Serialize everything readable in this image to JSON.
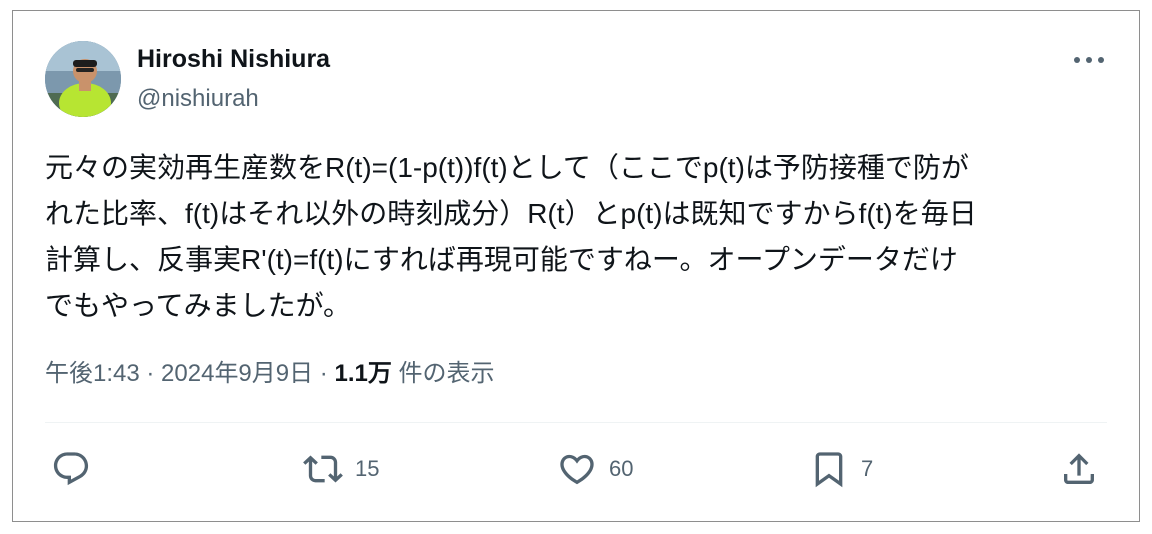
{
  "author": {
    "name": "Hiroshi Nishiura",
    "handle": "@nishiurah"
  },
  "tweet": {
    "lines": [
      "元々の実効再生産数をR(t)=(1-p(t))f(t)として（ここでp(t)は予防接種で防が",
      "れた比率、f(t)はそれ以外の時刻成分）R(t）とp(t)は既知ですからf(t)を毎日",
      "計算し、反事実R'(t)=f(t)にすれば再現可能ですねー。オープンデータだけ",
      "でもやってみましたが。"
    ]
  },
  "meta": {
    "time": "午後1:43",
    "sep1": " · ",
    "date": "2024年9月9日",
    "sep2": " · ",
    "views_count": "1.1万",
    "views_label": " 件の表示"
  },
  "actions": {
    "reply": {
      "icon": "reply-icon",
      "count": ""
    },
    "repost": {
      "icon": "repost-icon",
      "count": "15"
    },
    "like": {
      "icon": "heart-icon",
      "count": "60"
    },
    "bookmark": {
      "icon": "bookmark-icon",
      "count": "7"
    },
    "share": {
      "icon": "share-icon",
      "count": ""
    }
  },
  "colors": {
    "text": "#0f1419",
    "secondary": "#536471",
    "border": "#8e8e8e",
    "divider": "#eff3f4"
  }
}
